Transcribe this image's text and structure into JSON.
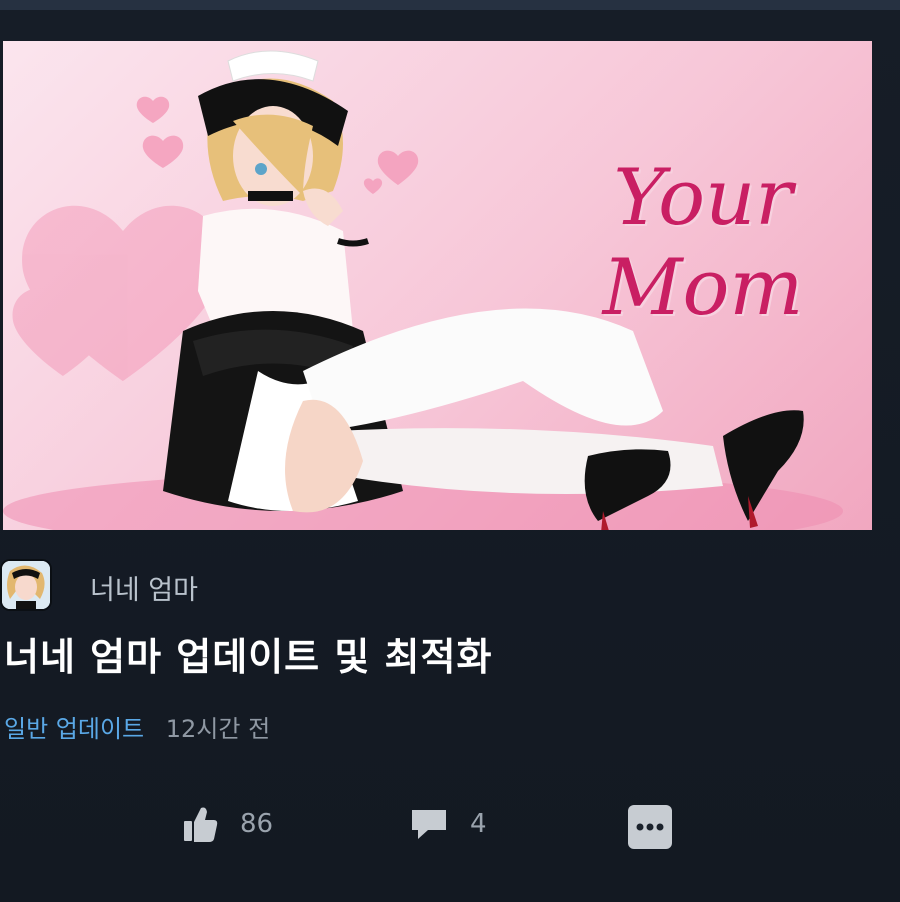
{
  "hero": {
    "title_line1": "Your",
    "title_line2": "Mom",
    "icons": [
      "heart-icon"
    ]
  },
  "post": {
    "game_icon": "game-icon",
    "game_name": "너네 엄마",
    "title": "너네 엄마 업데이트 및 최적화",
    "category": "일반 업데이트",
    "time": "12시간 전"
  },
  "actions": {
    "like_icon": "thumbs-up-icon",
    "likes": "86",
    "comment_icon": "comment-icon",
    "comments": "4",
    "more_icon": "more-icon"
  },
  "colors": {
    "background": "#141a23",
    "accent_pink": "#c91f63",
    "category_blue": "#5aa8e6",
    "muted_text": "#8f98a3"
  }
}
